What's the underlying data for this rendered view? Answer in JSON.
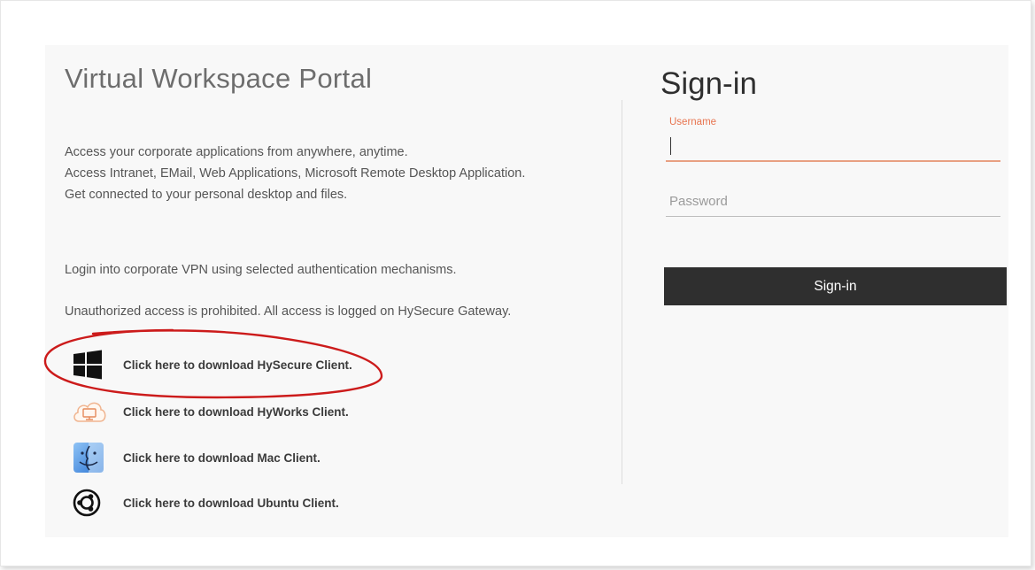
{
  "portal": {
    "title": "Virtual Workspace Portal",
    "description": [
      "Access your corporate applications from anywhere, anytime.",
      "Access Intranet, EMail, Web Applications, Microsoft Remote Desktop Application.",
      "Get connected to your personal desktop and files."
    ],
    "vpn_text": "Login into corporate VPN using selected authentication mechanisms.",
    "warning_text": "Unauthorized access is prohibited. All access is logged on HySecure Gateway."
  },
  "downloads": [
    {
      "label": "Click here to download HySecure Client.",
      "icon": "windows-icon"
    },
    {
      "label": "Click here to download HyWorks Client.",
      "icon": "hyworks-cloud-icon"
    },
    {
      "label": "Click here to download Mac Client.",
      "icon": "mac-finder-icon"
    },
    {
      "label": "Click here to download Ubuntu Client.",
      "icon": "ubuntu-icon"
    }
  ],
  "signin": {
    "title": "Sign-in",
    "username_label": "Username",
    "username_value": "",
    "password_placeholder": "Password",
    "button_label": "Sign-in"
  },
  "colors": {
    "accent": "#e8744f",
    "button_bg": "#2f2f2f",
    "highlight_circle": "#cc1b1b"
  }
}
